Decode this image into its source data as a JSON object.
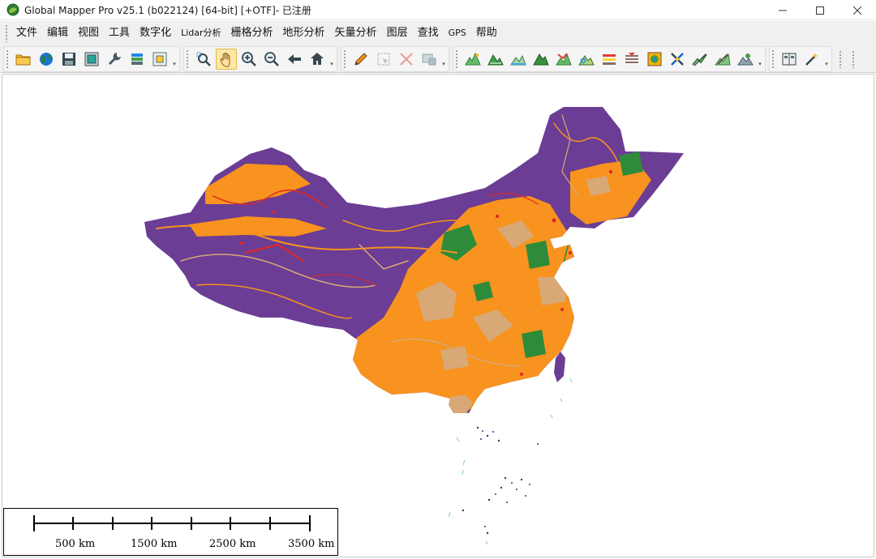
{
  "window": {
    "title": "Global Mapper Pro v25.1 (b022124) [64-bit] [+OTF]- 已注册",
    "controls": {
      "minimize": "—",
      "maximize": "☐",
      "close": "✕"
    }
  },
  "menu": {
    "items": [
      "文件",
      "编辑",
      "视图",
      "工具",
      "数字化",
      "Lidar分析",
      "栅格分析",
      "地形分析",
      "矢量分析",
      "图层",
      "查找",
      "GPS",
      "帮助"
    ]
  },
  "toolbar": {
    "groups": [
      {
        "icons": [
          "open-folder-icon",
          "globe-icon",
          "save-icon",
          "map-window-icon",
          "wrench-icon",
          "layers-icon",
          "frame-icon"
        ]
      },
      {
        "icons": [
          "zoom-box-icon",
          "pan-hand-icon",
          "zoom-in-icon",
          "zoom-out-icon",
          "back-arrow-icon",
          "home-icon"
        ],
        "active": "pan-hand-icon"
      },
      {
        "icons": [
          "pencil-icon",
          "select-icon",
          "delete-icon",
          "edit-attributes-icon"
        ]
      },
      {
        "icons": [
          "terrain-1-icon",
          "terrain-2-icon",
          "terrain-3-icon",
          "terrain-4-icon",
          "terrain-5-icon",
          "terrain-6-icon",
          "profile-icon",
          "contour-icon",
          "shade-icon",
          "tool-x-icon",
          "measure-icon",
          "digitize-icon",
          "viewshed-icon"
        ]
      },
      {
        "icons": [
          "split-view-icon",
          "magic-wand-icon"
        ]
      }
    ]
  },
  "map": {
    "colors": {
      "highland": "#6b3d95",
      "cropland": "#f7931e",
      "forest": "#2e8b3a",
      "grassland": "#d9a877",
      "urban": "#e0281e",
      "water": "#7ec8c8"
    }
  },
  "scalebar": {
    "labels": [
      "500 km",
      "1500 km",
      "2500 km",
      "3500 km"
    ]
  }
}
